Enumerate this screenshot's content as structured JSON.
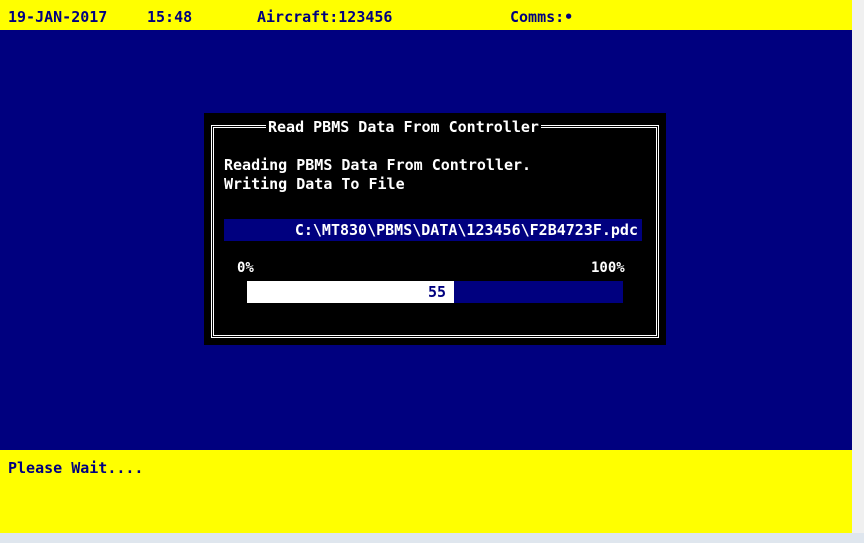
{
  "topbar": {
    "date": "19-JAN-2017",
    "time": "15:48",
    "aircraft": "Aircraft:123456",
    "comms": "Comms:•"
  },
  "dialog": {
    "title": "Read PBMS Data From Controller",
    "line1": "Reading PBMS Data From Controller.",
    "line2": "Writing Data To File",
    "file_path": "C:\\MT830\\PBMS\\DATA\\123456\\F2B4723F.pdc",
    "progress": {
      "min_label": "0%",
      "max_label": "100%",
      "value_text": "55",
      "value": 55
    }
  },
  "status": {
    "message": "Please Wait...."
  },
  "colors": {
    "bar_yellow": "#ffff00",
    "screen_blue": "#00007f",
    "dialog_black": "#000000",
    "text_white": "#ffffff"
  }
}
